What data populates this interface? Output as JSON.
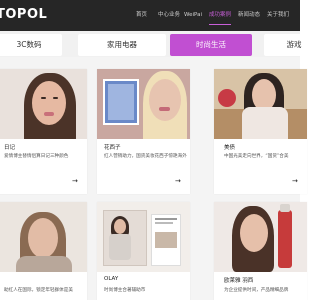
{
  "brand": {
    "logo_text": "TOPOL"
  },
  "nav": {
    "items": [
      {
        "label": "首页"
      },
      {
        "label": "中心业务"
      },
      {
        "label": "WeiPai"
      },
      {
        "label": "成功案例",
        "active": true
      },
      {
        "label": "新闻动态"
      },
      {
        "label": "关于我们"
      }
    ]
  },
  "tabs": [
    {
      "label": "3C数码"
    },
    {
      "label": "家用电器"
    },
    {
      "label": "时尚生活",
      "active": true
    },
    {
      "label": "游戏"
    }
  ],
  "cards": [
    {
      "title": "日记",
      "desc": "爱情博主替情侣算日记三种颜色",
      "arrow": "→"
    },
    {
      "title": "花西子",
      "desc": "红人营销助力，国货美妆花西子惊艳海外",
      "arrow": "→"
    },
    {
      "title": "美债",
      "desc": "中国光美走向世界，“国货”合美",
      "arrow": "→"
    },
    {
      "title": "",
      "desc": "助红人在国际，锁定年轻群体是美"
    },
    {
      "title": "OLAY",
      "desc": "时尚博主合著辅助市"
    },
    {
      "title": "欧莱雅 羽西",
      "desc": "为企业提供时间，产品精细品牌"
    }
  ],
  "colors": {
    "accent": "#c14fd2",
    "nav_bg": "#262626"
  }
}
